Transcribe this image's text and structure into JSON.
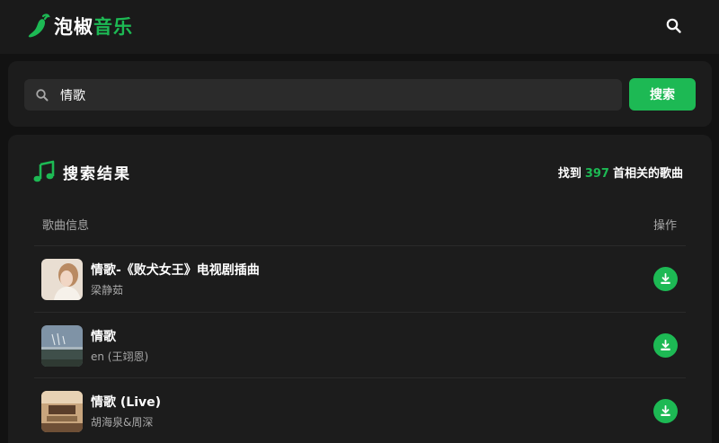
{
  "header": {
    "logo_main": "泡椒",
    "logo_accent": "音乐",
    "search_icon": "search-icon"
  },
  "search": {
    "value": "情歌",
    "placeholder": "",
    "button_label": "搜索"
  },
  "results": {
    "title": "搜索结果",
    "count_prefix": "找到",
    "count": "397",
    "count_suffix": "首相关的歌曲",
    "col_info": "歌曲信息",
    "col_action": "操作",
    "songs": [
      {
        "name": "情歌-《败犬女王》电视剧插曲",
        "artist": "梁静茹",
        "cover": "portrait"
      },
      {
        "name": "情歌",
        "artist": "en (王翊恩)",
        "cover": "landscape"
      },
      {
        "name": "情歌 (Live)",
        "artist": "胡海泉&周深",
        "cover": "stage"
      }
    ]
  },
  "colors": {
    "accent": "#1db954",
    "background": "#121212",
    "card": "#1c1c1c",
    "input": "#2b2b2b",
    "muted_text": "#a7a7a7"
  }
}
